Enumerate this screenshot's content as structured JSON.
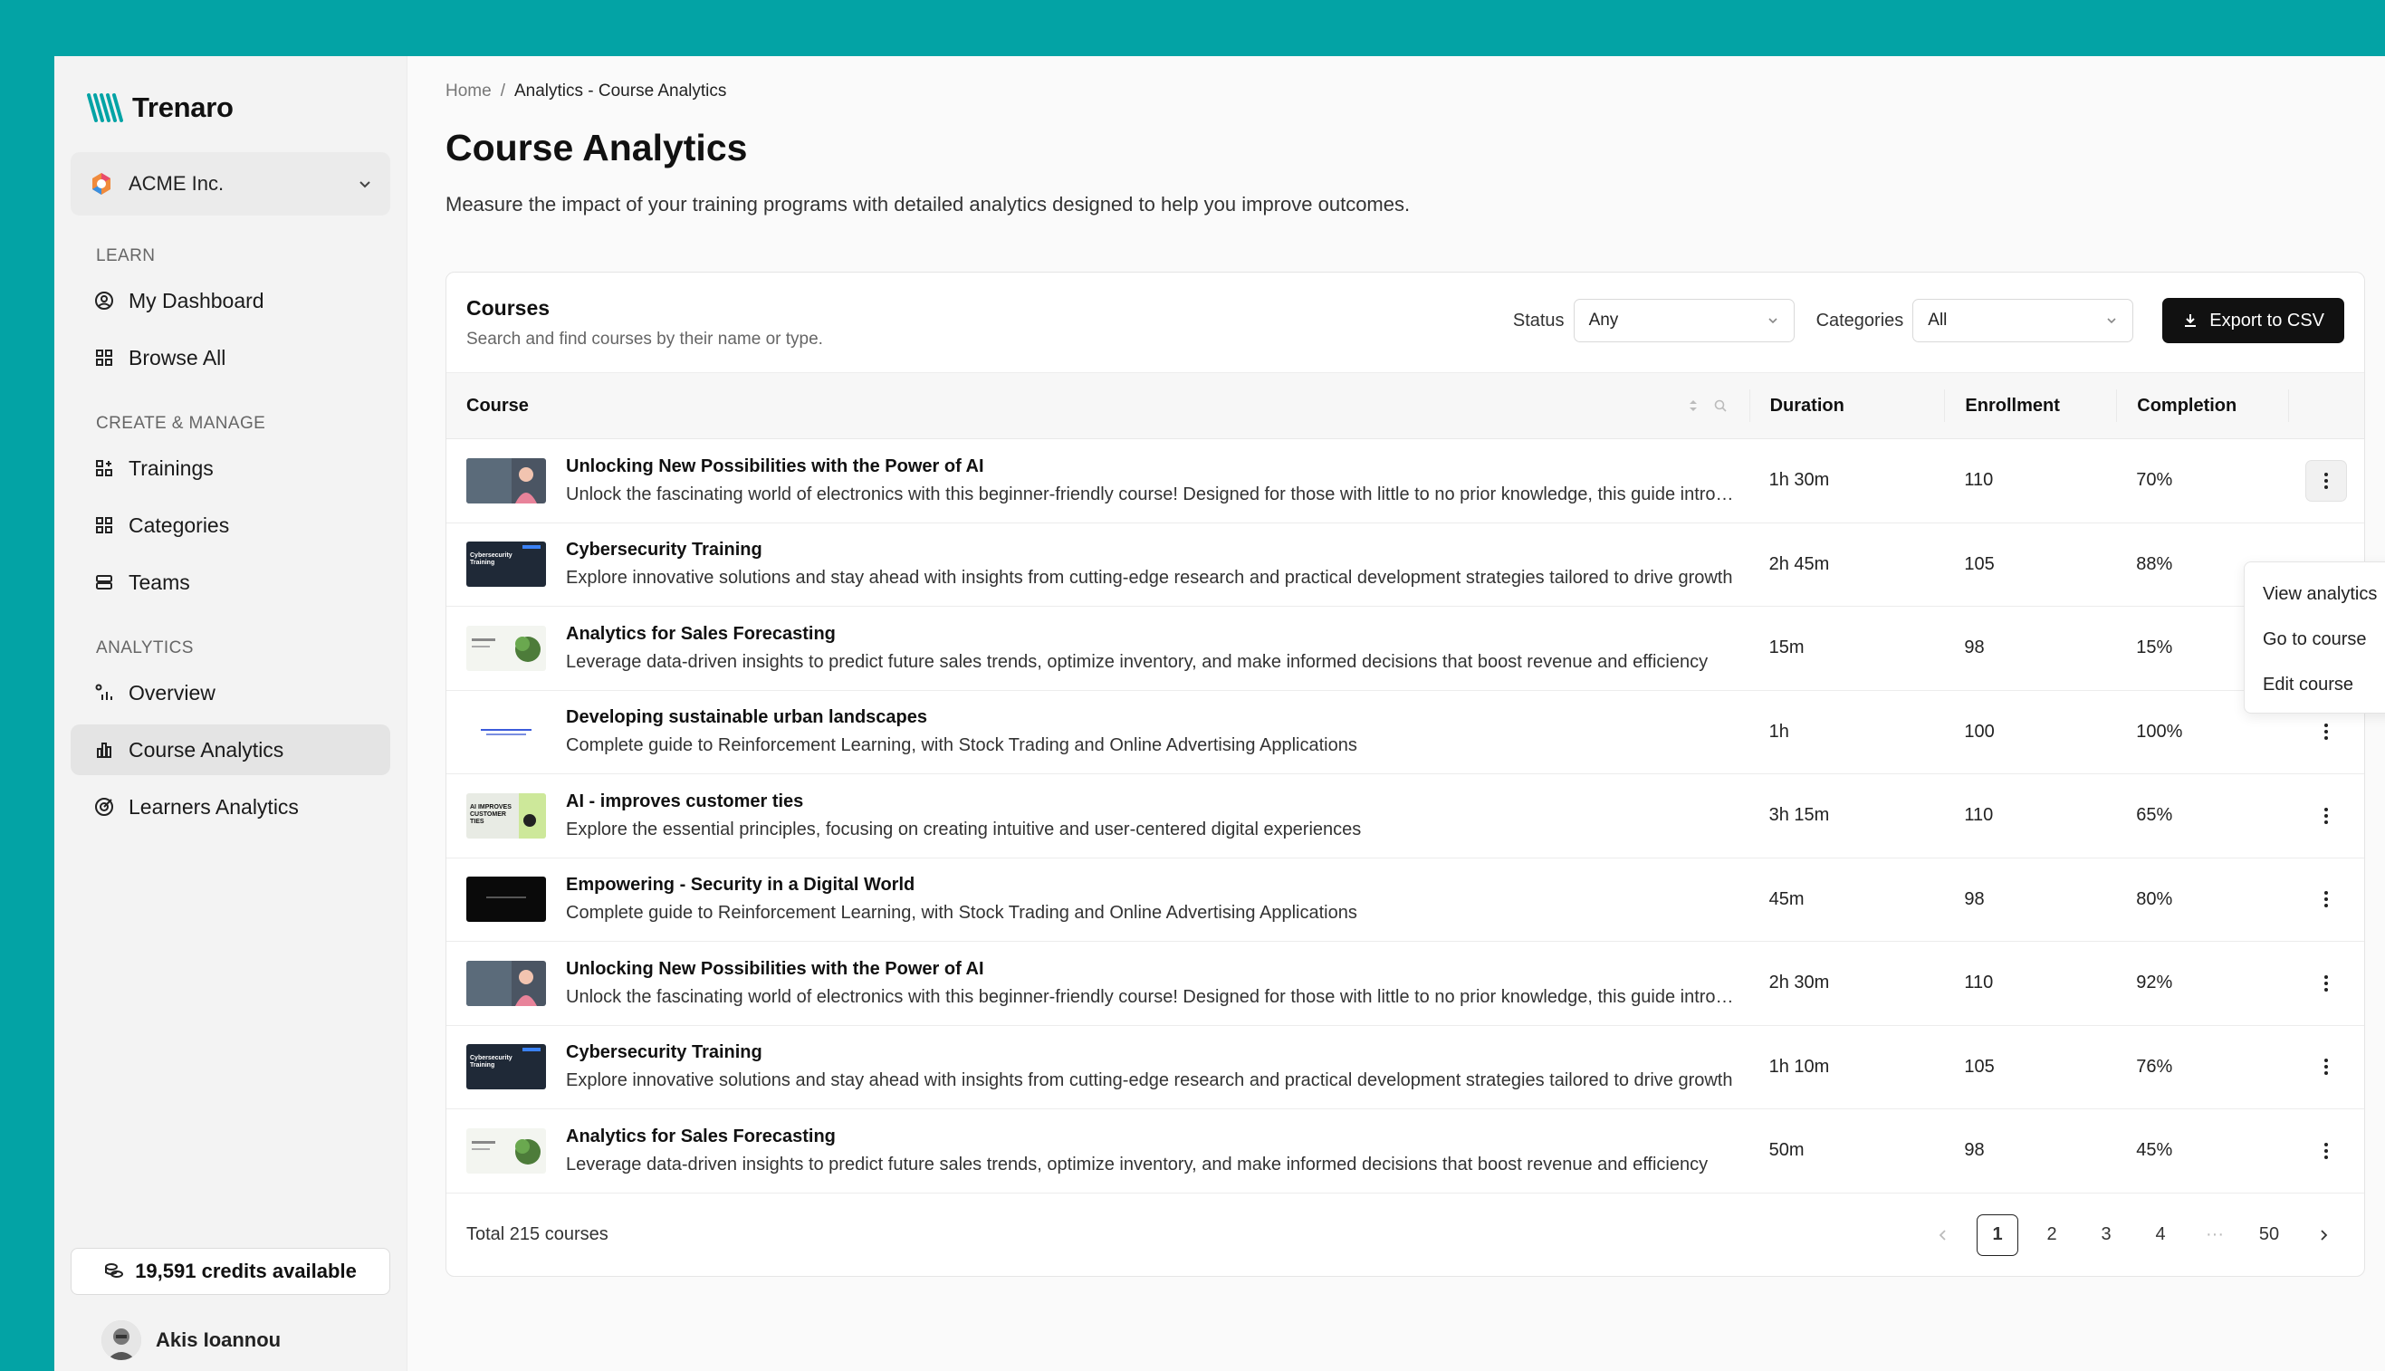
{
  "app": {
    "name": "Trenaro",
    "org": "ACME Inc."
  },
  "sidebar": {
    "sections": [
      {
        "label": "LEARN",
        "items": [
          {
            "label": "My Dashboard"
          },
          {
            "label": "Browse All"
          }
        ]
      },
      {
        "label": "CREATE & MANAGE",
        "items": [
          {
            "label": "Trainings"
          },
          {
            "label": "Categories"
          },
          {
            "label": "Teams"
          }
        ]
      },
      {
        "label": "ANALYTICS",
        "items": [
          {
            "label": "Overview"
          },
          {
            "label": "Course Analytics"
          },
          {
            "label": "Learners Analytics"
          }
        ]
      }
    ],
    "credits": "19,591 credits available",
    "user": "Akis Ioannou"
  },
  "breadcrumb": {
    "home": "Home",
    "sep": "/",
    "current": "Analytics - Course Analytics"
  },
  "page": {
    "title": "Course Analytics",
    "subtitle": "Measure the impact of your training programs with detailed analytics designed to help you improve outcomes."
  },
  "card": {
    "title": "Courses",
    "subtitle": "Search and find courses by their name or type.",
    "status_label": "Status",
    "status_value": "Any",
    "categories_label": "Categories",
    "categories_value": "All",
    "export_label": "Export to CSV"
  },
  "table": {
    "headers": {
      "course": "Course",
      "duration": "Duration",
      "enrollment": "Enrollment",
      "completion": "Completion"
    },
    "rows": [
      {
        "title": "Unlocking New Possibilities with the Power of AI",
        "desc": "Unlock the fascinating world of electronics with this beginner-friendly course! Designed for those with little to no prior knowledge, this guide introduces the basics",
        "duration": "1h 30m",
        "enrollment": "110",
        "completion": "70%",
        "thumb": "person"
      },
      {
        "title": "Cybersecurity Training",
        "desc": "Explore innovative solutions and stay ahead with insights from cutting-edge research and practical development strategies tailored to drive growth",
        "duration": "2h 45m",
        "enrollment": "105",
        "completion": "88%",
        "thumb": "dark"
      },
      {
        "title": "Analytics for Sales Forecasting",
        "desc": "Leverage data-driven insights to predict future sales trends, optimize inventory, and make informed decisions that boost revenue and efficiency",
        "duration": "15m",
        "enrollment": "98",
        "completion": "15%",
        "thumb": "plant"
      },
      {
        "title": "Developing sustainable urban landscapes",
        "desc": "Complete guide to Reinforcement Learning, with Stock Trading and Online Advertising Applications",
        "duration": "1h",
        "enrollment": "100",
        "completion": "100%",
        "thumb": "white"
      },
      {
        "title": "AI - improves customer ties",
        "desc": "Explore the essential principles, focusing on creating intuitive and user-centered digital experiences",
        "duration": "3h 15m",
        "enrollment": "110",
        "completion": "65%",
        "thumb": "ai"
      },
      {
        "title": "Empowering - Security in a Digital World",
        "desc": "Complete guide to Reinforcement Learning, with Stock Trading and Online Advertising Applications",
        "duration": "45m",
        "enrollment": "98",
        "completion": "80%",
        "thumb": "black"
      },
      {
        "title": "Unlocking New Possibilities with the Power of AI",
        "desc": "Unlock the fascinating world of electronics with this beginner-friendly course! Designed for those with little to no prior knowledge, this guide introduces the basics",
        "duration": "2h 30m",
        "enrollment": "110",
        "completion": "92%",
        "thumb": "person"
      },
      {
        "title": "Cybersecurity Training",
        "desc": "Explore innovative solutions and stay ahead with insights from cutting-edge research and practical development strategies tailored to drive growth",
        "duration": "1h 10m",
        "enrollment": "105",
        "completion": "76%",
        "thumb": "dark"
      },
      {
        "title": "Analytics for Sales Forecasting",
        "desc": "Leverage data-driven insights to predict future sales trends, optimize inventory, and make informed decisions that boost revenue and efficiency",
        "duration": "50m",
        "enrollment": "98",
        "completion": "45%",
        "thumb": "plant"
      }
    ],
    "total": "Total 215 courses",
    "pages": [
      "1",
      "2",
      "3",
      "4",
      "···",
      "50"
    ]
  },
  "thumb_text": {
    "dark": "Cybersecurity Training",
    "ai": "AI IMPROVES CUSTOMER TIES"
  },
  "dropdown": {
    "items": [
      "View analytics",
      "Go to course",
      "Edit course"
    ]
  },
  "colors": {
    "background": "#03a3a5",
    "button": "#111111",
    "active_nav": "#e4e4e4"
  }
}
